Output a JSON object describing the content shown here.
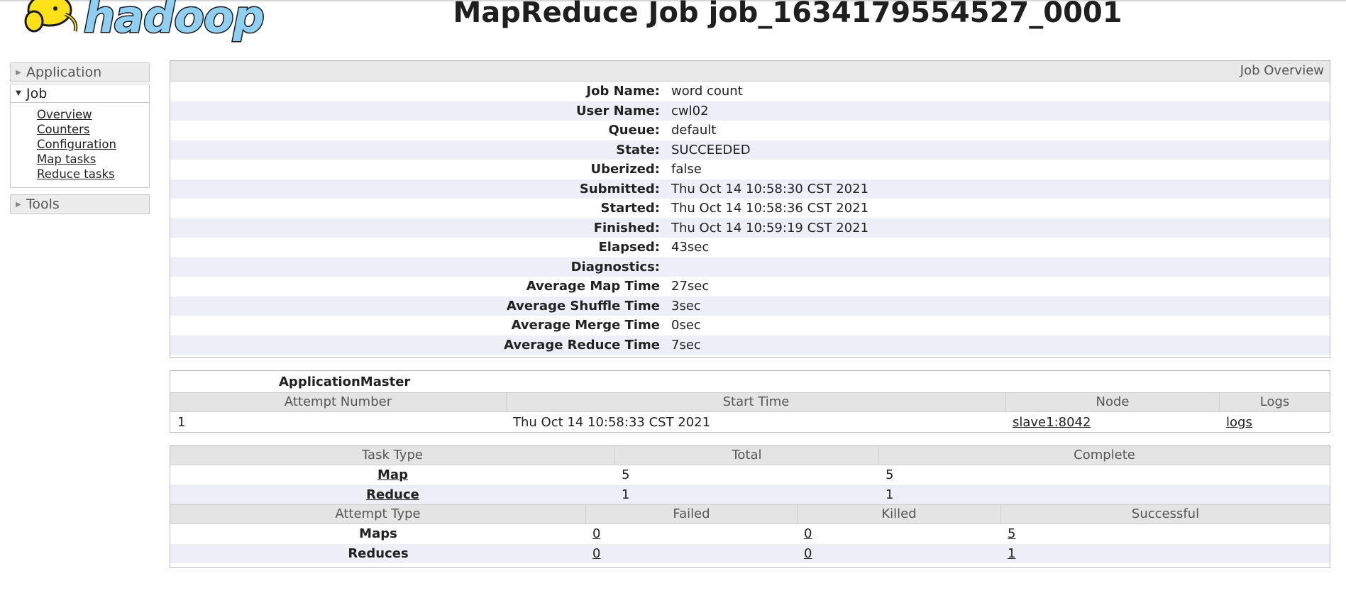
{
  "header": {
    "logo_text": "hadoop",
    "title": "MapReduce Job job_1634179554527_0001"
  },
  "sidebar": {
    "application": {
      "label": "Application"
    },
    "job": {
      "label": "Job",
      "links": [
        "Overview",
        "Counters",
        "Configuration",
        "Map tasks",
        "Reduce tasks"
      ]
    },
    "tools": {
      "label": "Tools"
    }
  },
  "overview": {
    "caption": "Job Overview",
    "rows": [
      {
        "key": "Job Name:",
        "value": "word count"
      },
      {
        "key": "User Name:",
        "value": "cwl02"
      },
      {
        "key": "Queue:",
        "value": "default"
      },
      {
        "key": "State:",
        "value": "SUCCEEDED"
      },
      {
        "key": "Uberized:",
        "value": "false"
      },
      {
        "key": "Submitted:",
        "value": "Thu Oct 14 10:58:30 CST 2021"
      },
      {
        "key": "Started:",
        "value": "Thu Oct 14 10:58:36 CST 2021"
      },
      {
        "key": "Finished:",
        "value": "Thu Oct 14 10:59:19 CST 2021"
      },
      {
        "key": "Elapsed:",
        "value": "43sec"
      },
      {
        "key": "Diagnostics:",
        "value": ""
      },
      {
        "key": "Average Map Time",
        "value": "27sec"
      },
      {
        "key": "Average Shuffle Time",
        "value": "3sec"
      },
      {
        "key": "Average Merge Time",
        "value": "0sec"
      },
      {
        "key": "Average Reduce Time",
        "value": "7sec"
      }
    ]
  },
  "app_master": {
    "title": "ApplicationMaster",
    "headers": [
      "Attempt Number",
      "Start Time",
      "Node",
      "Logs"
    ],
    "row": {
      "attempt": "1",
      "start_time": "Thu Oct 14 10:58:33 CST 2021",
      "node": "slave1:8042",
      "logs": "logs"
    }
  },
  "tasks": {
    "headers": [
      "Task Type",
      "Total",
      "Complete"
    ],
    "rows": [
      {
        "type": "Map",
        "total": "5",
        "complete": "5"
      },
      {
        "type": "Reduce",
        "total": "1",
        "complete": "1"
      }
    ],
    "attempt_headers": [
      "Attempt Type",
      "Failed",
      "Killed",
      "Successful"
    ],
    "attempt_rows": [
      {
        "type": "Maps",
        "failed": "0",
        "killed": "0",
        "successful": "5"
      },
      {
        "type": "Reduces",
        "failed": "0",
        "killed": "0",
        "successful": "1"
      }
    ]
  },
  "colors": {
    "odd_row": "#eeeef9",
    "header_bg": "#e4e4e4",
    "logo_fill": "#8fd0f2",
    "logo_elephant": "#ffe11a"
  }
}
